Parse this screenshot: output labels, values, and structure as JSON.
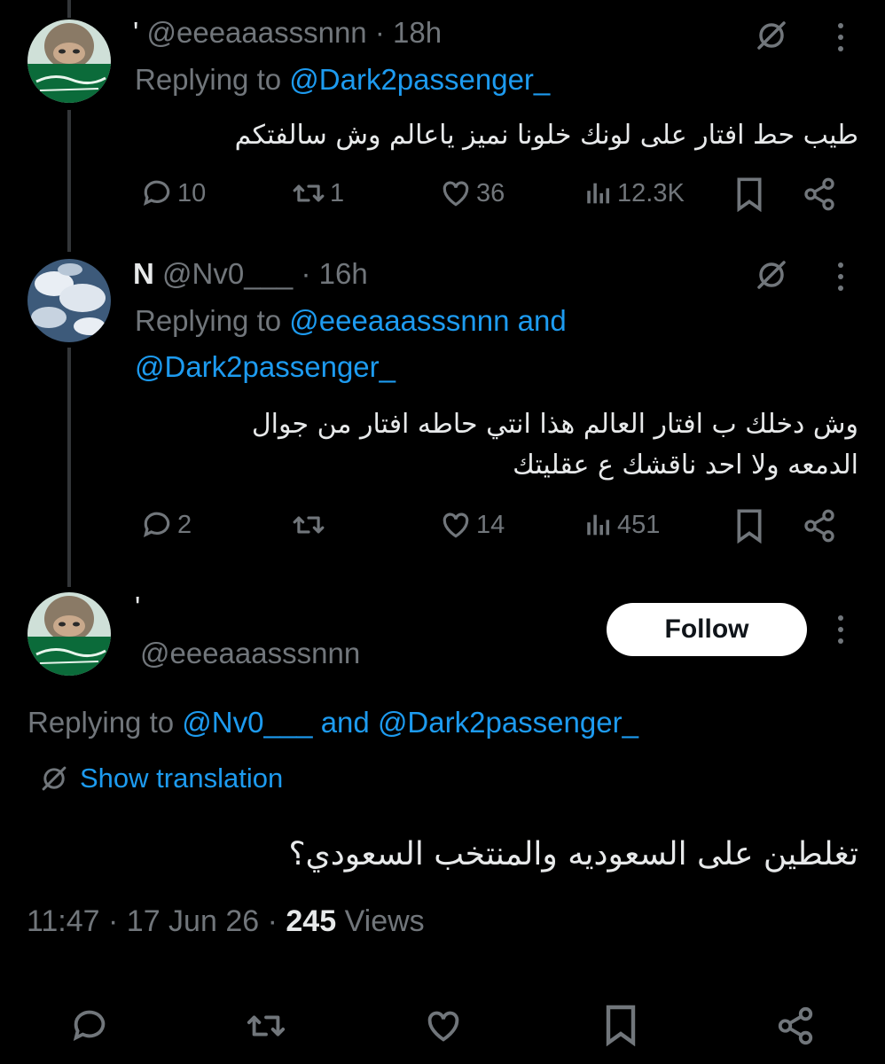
{
  "tweet1": {
    "name": "'",
    "handle": "@eeeaaasssnnn",
    "time": "18h",
    "replying_prefix": "Replying to",
    "replying_to": "@Dark2passenger_",
    "text": "طيب حط افتار على لونك خلونا نميز ياعالم وش سالفتكم",
    "replies": "10",
    "reposts": "1",
    "likes": "36",
    "views": "12.3K"
  },
  "tweet2": {
    "name": "N",
    "handle": "@Nv0___",
    "time": "16h",
    "replying_prefix": "Replying to",
    "replying_to_1": "@eeeaaasssnnn",
    "replying_and": "and",
    "replying_to_2": "@Dark2passenger_",
    "text_line1": "وش دخلك ب افتار العالم هذا انتي حاطه افتار من جوال",
    "text_line2": "الدمعه ولا احد ناقشك ع عقليتك",
    "replies": "2",
    "likes": "14",
    "views": "451"
  },
  "main_tweet": {
    "name": "'",
    "handle": "@eeeaaasssnnn",
    "follow_label": "Follow",
    "replying_prefix": "Replying to",
    "replying_to_1": "@Nv0___",
    "replying_and": "and",
    "replying_to_2": "@Dark2passenger_",
    "show_translation": "Show translation",
    "text": "تغلطين على السعوديه والمنتخب السعودي؟",
    "time": "11:47",
    "date": "17 Jun 26",
    "views_count": "245",
    "views_label": "Views"
  },
  "icons": [
    "grok-icon",
    "more-icon",
    "reply-icon",
    "repost-icon",
    "like-icon",
    "views-icon",
    "bookmark-icon",
    "share-icon",
    "translate-icon"
  ],
  "colors": {
    "background": "#000000",
    "text": "#e7e9ea",
    "muted": "#71767b",
    "link": "#1d9bf0",
    "follow_bg": "#ffffff"
  }
}
